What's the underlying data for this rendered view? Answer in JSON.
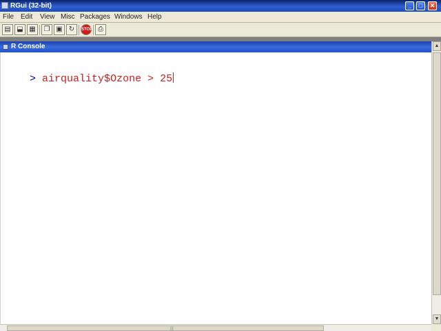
{
  "app": {
    "title": "RGui (32-bit)",
    "min_icon": "minimize-icon",
    "max_icon": "maximize-icon",
    "close_icon": "close-icon"
  },
  "menubar": {
    "items": [
      "File",
      "Edit",
      "View",
      "Misc",
      "Packages",
      "Windows",
      "Help"
    ]
  },
  "toolbar": {
    "buttons": [
      {
        "icon": "open-script-icon",
        "glyph": "▤"
      },
      {
        "icon": "load-workspace-icon",
        "glyph": "⬓"
      },
      {
        "icon": "save-icon",
        "glyph": "▦"
      },
      {
        "icon": "copy-icon",
        "glyph": "❐"
      },
      {
        "icon": "paste-icon",
        "glyph": "▣"
      },
      {
        "icon": "copy-paste-icon",
        "glyph": "↻"
      },
      {
        "icon": "stop-icon",
        "glyph": "STOP"
      },
      {
        "icon": "print-icon",
        "glyph": "⎙"
      }
    ]
  },
  "console": {
    "title": "R Console",
    "prompt": ">",
    "command": "airquality$Ozone > 25"
  },
  "colors": {
    "titlebar": "#0a246a",
    "console_titlebar": "#2150c8",
    "command_text": "#c8201c",
    "prompt_text": "#000080"
  }
}
